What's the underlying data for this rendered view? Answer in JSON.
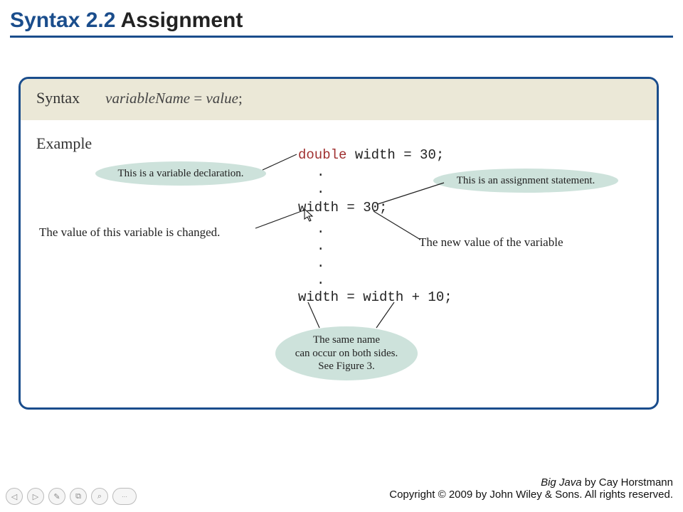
{
  "title": {
    "prefix": "Syntax 2.2",
    "suffix": " Assignment"
  },
  "syntax": {
    "label": "Syntax",
    "pattern_var": "variableName",
    "pattern_eq": " = ",
    "pattern_val": "value",
    "pattern_end": ";"
  },
  "example": {
    "label": "Example",
    "code": {
      "line1_kw": "double",
      "line1_rest": " width = 30;",
      "line2": "width = 30;",
      "line3": "width = width + 10;",
      "dot": "."
    }
  },
  "callouts": {
    "declaration": "This is a variable declaration.",
    "assignment": "This is an assignment statement.",
    "both_sides_l1": "The same name",
    "both_sides_l2": "can occur on both sides.",
    "both_sides_l3": "See Figure 3."
  },
  "notes": {
    "changed": "The value of this variable is changed.",
    "newvalue": "The new value of the variable"
  },
  "footer": {
    "book": "Big Java",
    "author": " by Cay Horstmann",
    "copyright": "Copyright © 2009 by John Wiley & Sons.  All rights reserved."
  },
  "nav": {
    "prev": "◁",
    "next": "▷",
    "pen": "✎",
    "copy": "⧉",
    "zoom": "⌕",
    "menu": "···"
  }
}
